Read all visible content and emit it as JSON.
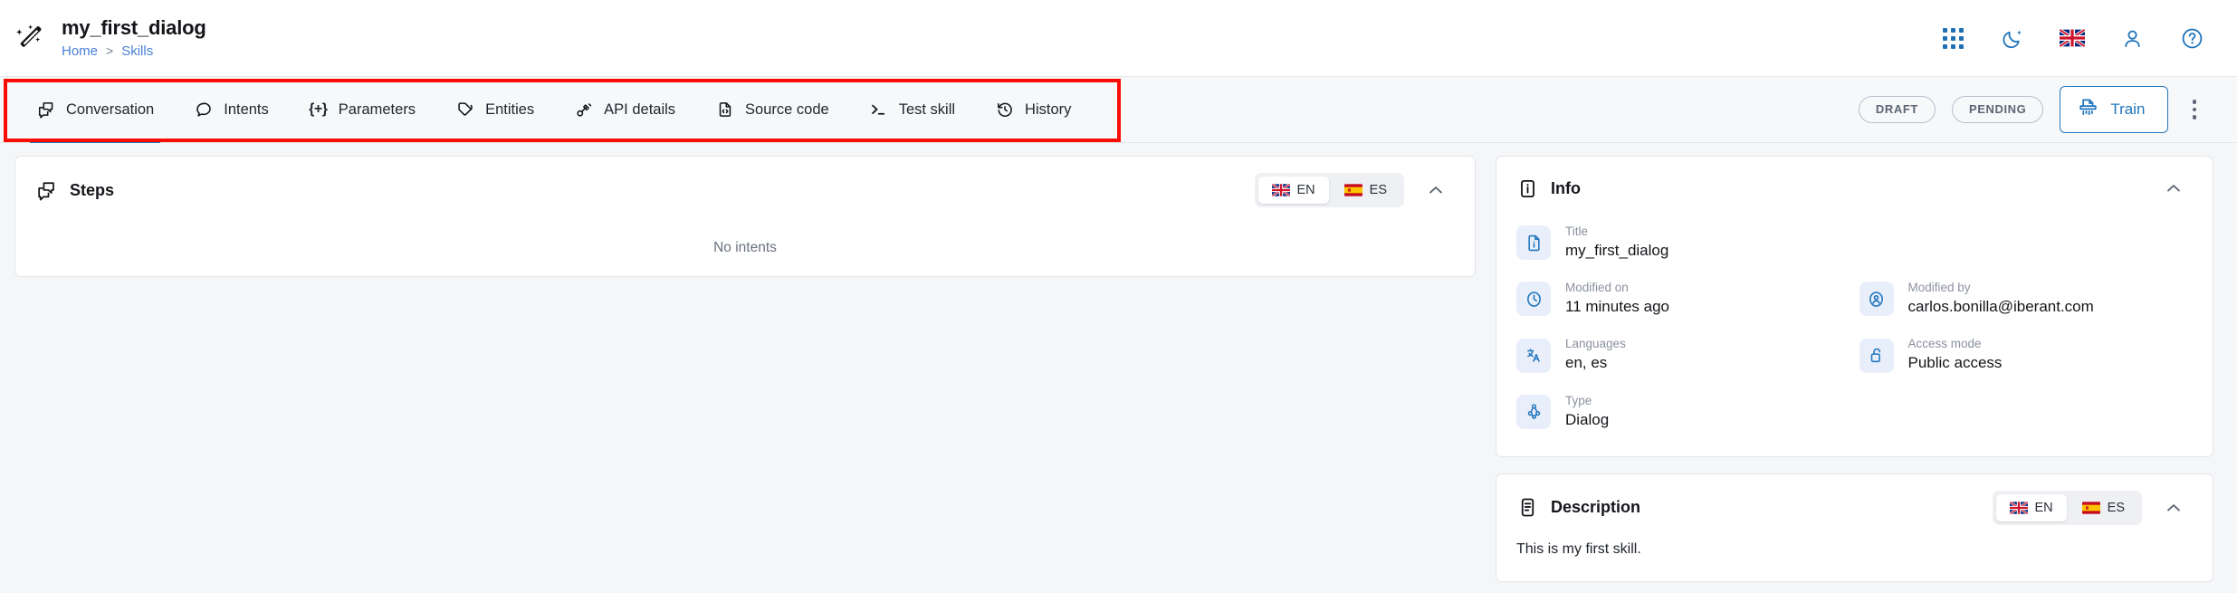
{
  "header": {
    "logo_icon": "magic-wand-icon",
    "title": "my_first_dialog",
    "breadcrumb": {
      "home": "Home",
      "separator": ">",
      "current": "Skills"
    },
    "icons": [
      {
        "name": "apps-grid-icon",
        "label": "Apps"
      },
      {
        "name": "dark-mode-moon-icon",
        "label": "Dark mode"
      },
      {
        "name": "language-flag-en-icon",
        "label": "EN"
      },
      {
        "name": "user-account-icon",
        "label": "Account"
      },
      {
        "name": "help-question-icon",
        "label": "Help"
      }
    ]
  },
  "tabs": [
    {
      "id": "conversation",
      "label": "Conversation",
      "icon": "conversation-icon",
      "active": true
    },
    {
      "id": "intents",
      "label": "Intents",
      "icon": "speech-bubble-icon",
      "active": false
    },
    {
      "id": "parameters",
      "label": "Parameters",
      "icon": "curly-brace-plus-icon",
      "active": false
    },
    {
      "id": "entities",
      "label": "Entities",
      "icon": "tag-icon",
      "active": false
    },
    {
      "id": "api-details",
      "label": "API details",
      "icon": "plug-connector-icon",
      "active": false
    },
    {
      "id": "source-code",
      "label": "Source code",
      "icon": "file-code-icon",
      "active": false
    },
    {
      "id": "test-skill",
      "label": "Test skill",
      "icon": "terminal-prompt-icon",
      "active": false
    },
    {
      "id": "history",
      "label": "History",
      "icon": "clock-history-icon",
      "active": false
    }
  ],
  "toolbar": {
    "status_draft": "DRAFT",
    "status_pending": "PENDING",
    "train_label": "Train",
    "train_icon": "train-shredder-icon",
    "overflow_icon": "kebab-menu-icon"
  },
  "annotation": {
    "color": "#fb0d05",
    "shape": "rectangle",
    "target": "tab-bar"
  },
  "steps_panel": {
    "title": "Steps",
    "icon": "conversation-icon",
    "empty_text": "No intents",
    "languages": [
      {
        "code": "EN",
        "flag": "uk-flag",
        "selected": true
      },
      {
        "code": "ES",
        "flag": "spain-flag",
        "selected": false
      }
    ],
    "collapse_icon": "chevron-up-icon"
  },
  "info_panel": {
    "title": "Info",
    "icon": "info-box-icon",
    "collapse_icon": "chevron-up-icon",
    "fields": [
      {
        "label": "Title",
        "value": "my_first_dialog",
        "icon": "document-info-icon"
      },
      {
        "label": "Modified on",
        "value": "11 minutes ago",
        "icon": "clock-icon"
      },
      {
        "label": "Modified by",
        "value": "carlos.bonilla@iberant.com",
        "icon": "user-circle-icon"
      },
      {
        "label": "Languages",
        "value": "en, es",
        "icon": "translate-icon"
      },
      {
        "label": "Access mode",
        "value": "Public access",
        "icon": "unlocked-padlock-icon"
      },
      {
        "label": "Type",
        "value": "Dialog",
        "icon": "node-tree-icon"
      }
    ]
  },
  "description_panel": {
    "title": "Description",
    "icon": "notes-document-icon",
    "text": "This is my first skill.",
    "collapse_icon": "chevron-up-icon",
    "languages": [
      {
        "code": "EN",
        "flag": "uk-flag",
        "selected": true
      },
      {
        "code": "ES",
        "flag": "spain-flag",
        "selected": false
      }
    ]
  },
  "colors": {
    "accent_blue": "#1479bd",
    "link_blue": "#4a7fd4",
    "annotation_red": "#fb0d05",
    "icon_blue": "#2176bd",
    "page_bg": "#f5f6f8"
  }
}
